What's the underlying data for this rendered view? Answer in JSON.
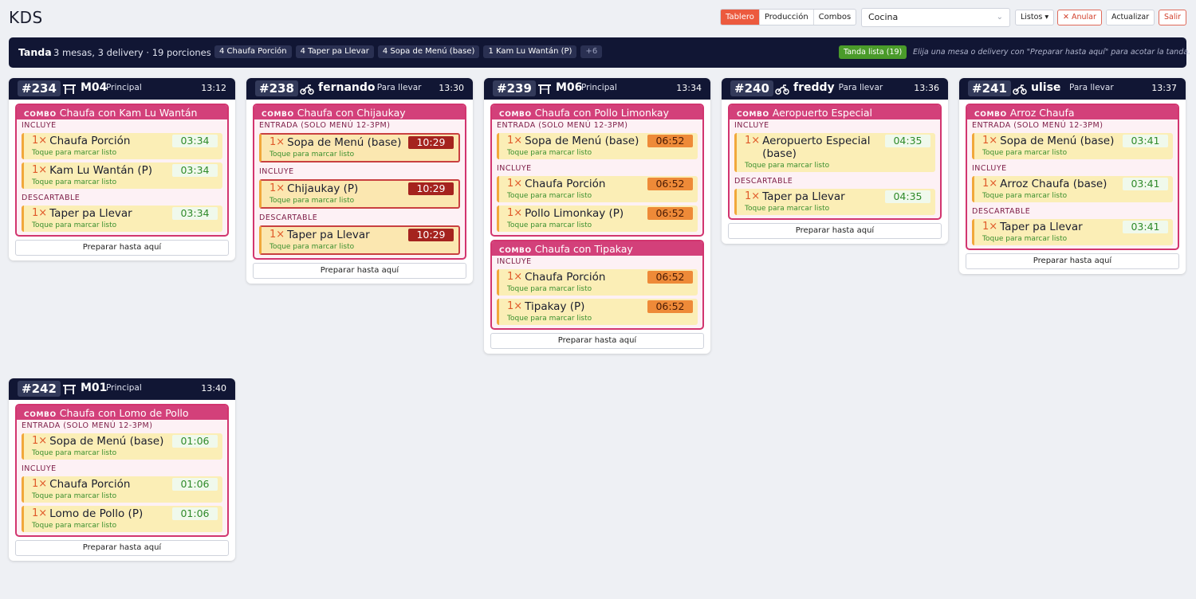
{
  "app": {
    "title": "KDS"
  },
  "toolbar": {
    "views": [
      "Tablero",
      "Producción",
      "Combos"
    ],
    "active_view": "Tablero",
    "station": "Cocina",
    "listos": "Listos ▾",
    "anular": "✕ Anular",
    "actualizar": "Actualizar",
    "salir": "Salir"
  },
  "tanda": {
    "label": "Tanda",
    "summary": "3 mesas, 3 delivery · 19 porciones",
    "chips": [
      "4 Chaufa Porción",
      "4 Taper pa Llevar",
      "4 Sopa de Menú (base)",
      "1 Kam Lu Wantán (P)",
      "+6"
    ],
    "ready_button": "Tanda lista (19)",
    "hint": "Elija una mesa o delivery con \"Preparar hasta aquí\" para acotar la tanda."
  },
  "common": {
    "combo_tag": "COMBO",
    "tap_hint": "Toque para marcar listo",
    "prep_button": "Preparar hasta aquí"
  },
  "colors": {
    "accent": "#ec5a3e",
    "header": "#111634",
    "combo": "#d3407a",
    "ok": "#2f8a2a",
    "warn": "#ee8a38",
    "crit": "#a5231e"
  },
  "orders": [
    {
      "number": "#234",
      "service": "table",
      "service_icon": "table-icon",
      "dest": "M04",
      "area": "Principal",
      "time": "13:12",
      "combos": [
        {
          "name": "Chaufa con Kam Lu Wantán",
          "sections": [
            {
              "title": "INCLUYE",
              "items": [
                {
                  "qty": "1×",
                  "name": "Chaufa Porción",
                  "timer": "03:34",
                  "status": "ok"
                },
                {
                  "qty": "1×",
                  "name": "Kam Lu Wantán (P)",
                  "timer": "03:34",
                  "status": "ok"
                }
              ]
            },
            {
              "title": "DESCARTABLE",
              "items": [
                {
                  "qty": "1×",
                  "name": "Taper pa Llevar",
                  "timer": "03:34",
                  "status": "ok"
                }
              ]
            }
          ]
        }
      ]
    },
    {
      "number": "#238",
      "service": "delivery",
      "service_icon": "motorbike-icon",
      "dest": "fernando",
      "area": "Para llevar",
      "time": "13:30",
      "combos": [
        {
          "name": "Chaufa con Chijaukay",
          "sections": [
            {
              "title": "ENTRADA (SOLO MENÚ 12-3PM)",
              "items": [
                {
                  "qty": "1×",
                  "name": "Sopa de Menú (base)",
                  "timer": "10:29",
                  "status": "crit"
                }
              ]
            },
            {
              "title": "INCLUYE",
              "items": [
                {
                  "qty": "1×",
                  "name": "Chijaukay (P)",
                  "timer": "10:29",
                  "status": "crit"
                }
              ]
            },
            {
              "title": "DESCARTABLE",
              "items": [
                {
                  "qty": "1×",
                  "name": "Taper pa Llevar",
                  "timer": "10:29",
                  "status": "crit"
                }
              ]
            }
          ]
        }
      ]
    },
    {
      "number": "#239",
      "service": "table",
      "service_icon": "table-icon",
      "dest": "M06",
      "area": "Principal",
      "time": "13:34",
      "combos": [
        {
          "name": "Chaufa con Pollo Limonkay",
          "sections": [
            {
              "title": "ENTRADA (SOLO MENÚ 12-3PM)",
              "items": [
                {
                  "qty": "1×",
                  "name": "Sopa de Menú (base)",
                  "timer": "06:52",
                  "status": "warn"
                }
              ]
            },
            {
              "title": "INCLUYE",
              "items": [
                {
                  "qty": "1×",
                  "name": "Chaufa Porción",
                  "timer": "06:52",
                  "status": "warn"
                },
                {
                  "qty": "1×",
                  "name": "Pollo Limonkay (P)",
                  "timer": "06:52",
                  "status": "warn"
                }
              ]
            }
          ]
        },
        {
          "name": "Chaufa con Tipakay",
          "sections": [
            {
              "title": "INCLUYE",
              "items": [
                {
                  "qty": "1×",
                  "name": "Chaufa Porción",
                  "timer": "06:52",
                  "status": "warn"
                },
                {
                  "qty": "1×",
                  "name": "Tipakay (P)",
                  "timer": "06:52",
                  "status": "warn"
                }
              ]
            }
          ]
        }
      ]
    },
    {
      "number": "#240",
      "service": "delivery",
      "service_icon": "motorbike-icon",
      "dest": "freddy",
      "area": "Para llevar",
      "time": "13:36",
      "combos": [
        {
          "name": "Aeropuerto Especial",
          "sections": [
            {
              "title": "INCLUYE",
              "items": [
                {
                  "qty": "1×",
                  "name": "Aeropuerto Especial (base)",
                  "timer": "04:35",
                  "status": "ok"
                }
              ]
            },
            {
              "title": "DESCARTABLE",
              "items": [
                {
                  "qty": "1×",
                  "name": "Taper pa Llevar",
                  "timer": "04:35",
                  "status": "ok"
                }
              ]
            }
          ]
        }
      ]
    },
    {
      "number": "#241",
      "service": "delivery",
      "service_icon": "motorbike-icon",
      "dest": "ulise",
      "area": "Para llevar",
      "time": "13:37",
      "combos": [
        {
          "name": "Arroz Chaufa",
          "sections": [
            {
              "title": "ENTRADA (SOLO MENÚ 12-3PM)",
              "items": [
                {
                  "qty": "1×",
                  "name": "Sopa de Menú (base)",
                  "timer": "03:41",
                  "status": "ok"
                }
              ]
            },
            {
              "title": "INCLUYE",
              "items": [
                {
                  "qty": "1×",
                  "name": "Arroz Chaufa (base)",
                  "timer": "03:41",
                  "status": "ok"
                }
              ]
            },
            {
              "title": "DESCARTABLE",
              "items": [
                {
                  "qty": "1×",
                  "name": "Taper pa Llevar",
                  "timer": "03:41",
                  "status": "ok"
                }
              ]
            }
          ]
        }
      ]
    },
    {
      "number": "#242",
      "service": "table",
      "service_icon": "table-icon",
      "dest": "M01",
      "area": "Principal",
      "time": "13:40",
      "combos": [
        {
          "name": "Chaufa con Lomo de Pollo",
          "sections": [
            {
              "title": "ENTRADA (SOLO MENÚ 12-3PM)",
              "items": [
                {
                  "qty": "1×",
                  "name": "Sopa de Menú (base)",
                  "timer": "01:06",
                  "status": "ok"
                }
              ]
            },
            {
              "title": "INCLUYE",
              "items": [
                {
                  "qty": "1×",
                  "name": "Chaufa Porción",
                  "timer": "01:06",
                  "status": "ok"
                },
                {
                  "qty": "1×",
                  "name": "Lomo de Pollo (P)",
                  "timer": "01:06",
                  "status": "ok"
                }
              ]
            }
          ]
        }
      ]
    }
  ]
}
